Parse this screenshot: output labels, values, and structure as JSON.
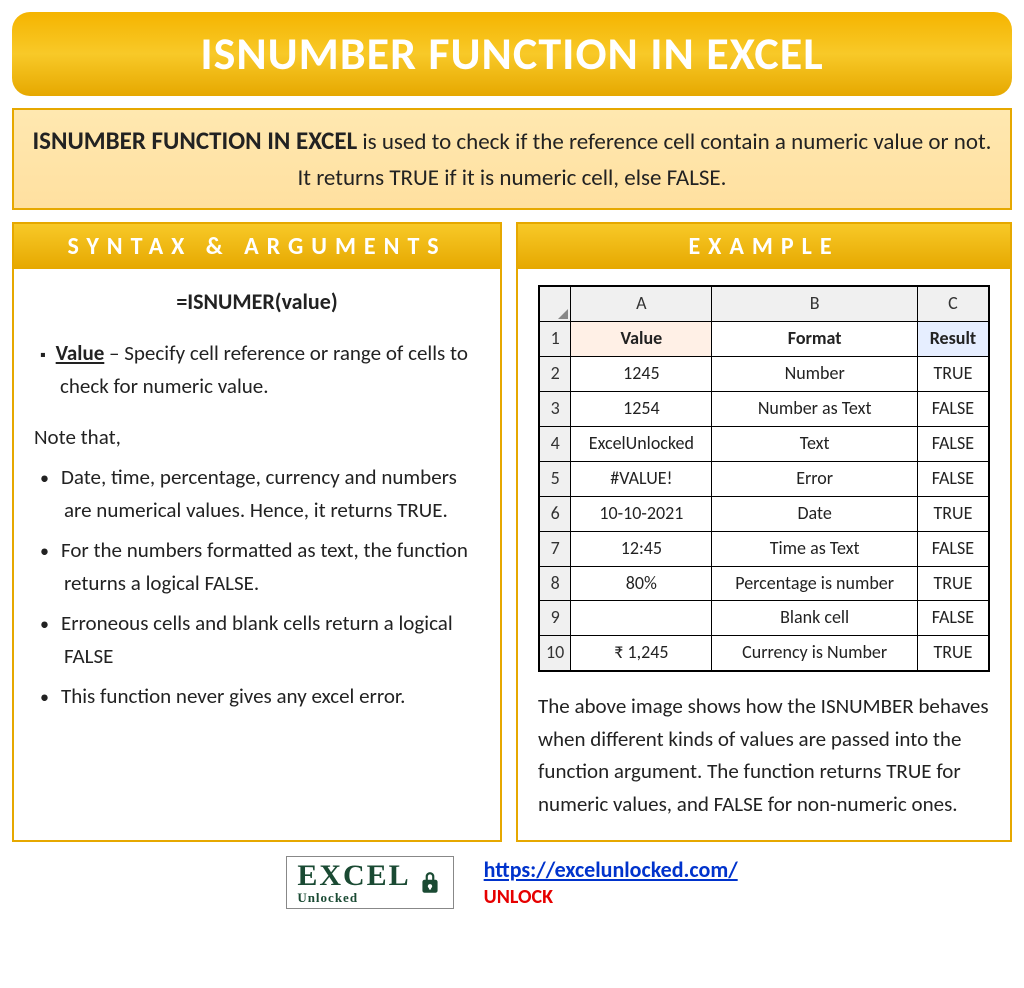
{
  "title": "ISNUMBER FUNCTION IN EXCEL",
  "intro": {
    "bold": "ISNUMBER FUNCTION IN EXCEL",
    "rest": " is used to check if the reference cell contain a numeric value or not. It returns TRUE if it is numeric cell, else FALSE."
  },
  "left": {
    "header": "SYNTAX & ARGUMENTS",
    "formula": "=ISNUMER(value)",
    "arg_label": "Value",
    "arg_text": " – Specify cell reference or range of cells to check for numeric value.",
    "note_head": "Note that,",
    "notes": [
      "Date, time, percentage, currency and numbers are numerical values. Hence, it returns TRUE.",
      "For the numbers formatted as text, the function returns a logical FALSE.",
      "Erroneous cells and blank cells return a logical FALSE",
      "This function never gives any excel error."
    ]
  },
  "right": {
    "header": "EXAMPLE",
    "cols": [
      "A",
      "B",
      "C"
    ],
    "headers": [
      "Value",
      "Format",
      "Result"
    ],
    "rows": [
      {
        "n": "2",
        "a": "1245",
        "b": "Number",
        "c": "TRUE"
      },
      {
        "n": "3",
        "a": "1254",
        "b": "Number as Text",
        "c": "FALSE"
      },
      {
        "n": "4",
        "a": "ExcelUnlocked",
        "b": "Text",
        "c": "FALSE"
      },
      {
        "n": "5",
        "a": "#VALUE!",
        "b": "Error",
        "c": "FALSE"
      },
      {
        "n": "6",
        "a": "10-10-2021",
        "b": "Date",
        "c": "TRUE"
      },
      {
        "n": "7",
        "a": "12:45",
        "b": "Time as Text",
        "c": "FALSE"
      },
      {
        "n": "8",
        "a": "80%",
        "b": "Percentage is number",
        "c": "TRUE"
      },
      {
        "n": "9",
        "a": "",
        "b": "Blank cell",
        "c": "FALSE"
      },
      {
        "n": "10",
        "a": "₹ 1,245",
        "b": "Currency is Number",
        "c": "TRUE"
      }
    ],
    "explain": "The above image shows how the ISNUMBER behaves when different kinds of values are passed into the function argument. The function returns TRUE for numeric values, and FALSE for non-numeric ones."
  },
  "footer": {
    "logo_main": "EXCEL",
    "logo_sub": "Unlocked",
    "url": "https://excelunlocked.com/",
    "unlock": "UNLOCK"
  }
}
